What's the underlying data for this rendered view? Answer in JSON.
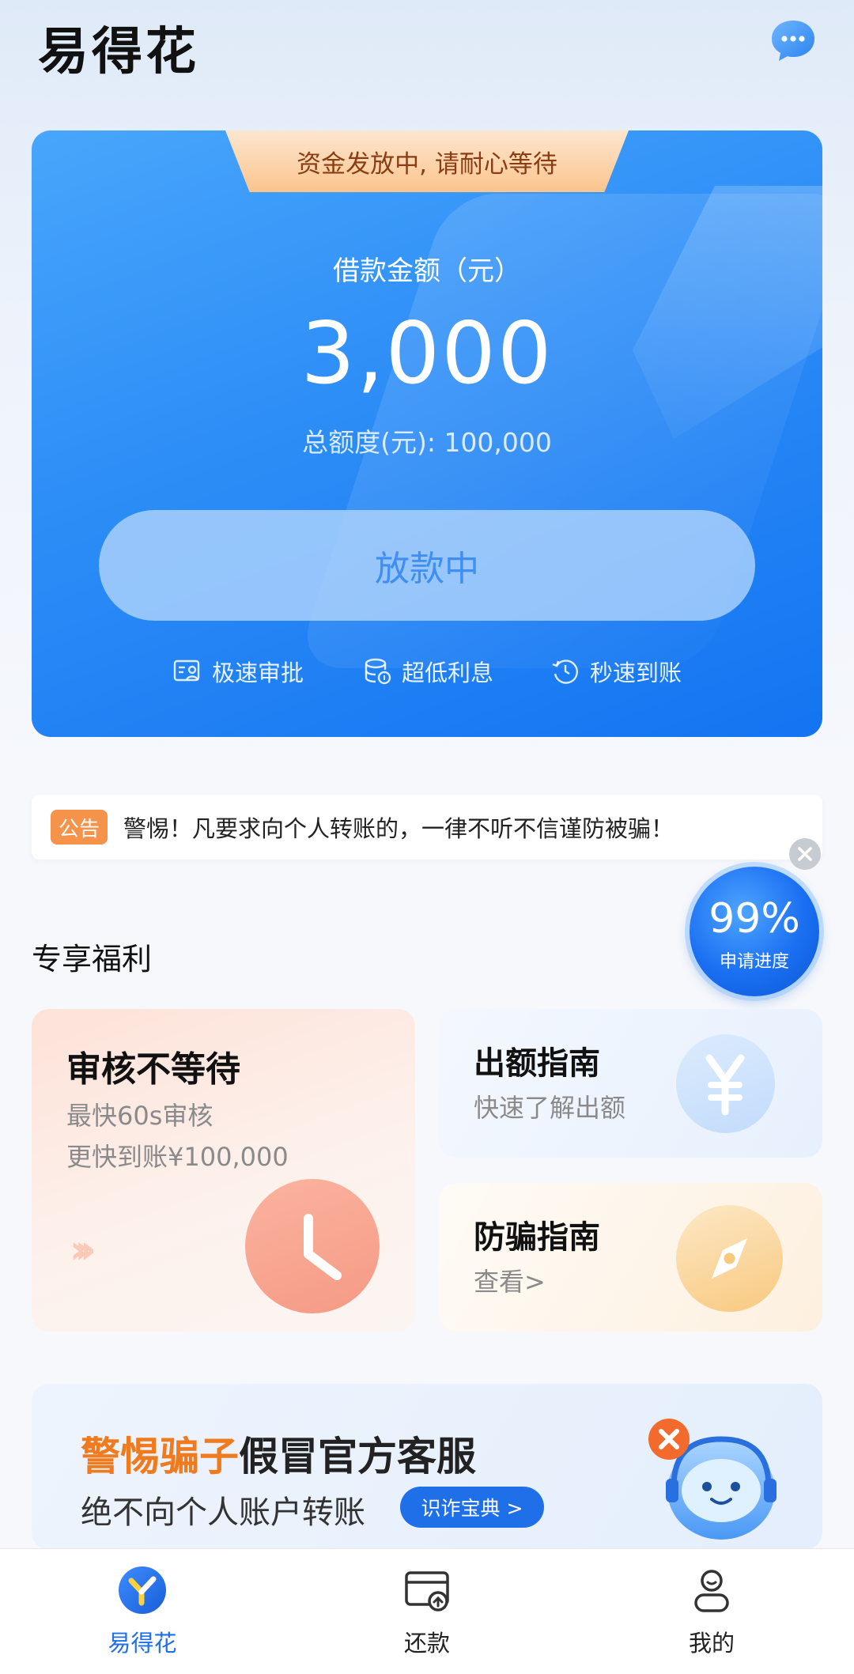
{
  "header": {
    "app_title": "易得花"
  },
  "hero": {
    "banner_text": "资金发放中, 请耐心等待",
    "loan_label": "借款金额（元）",
    "loan_amount": "3,000",
    "total_limit": "总额度(元): 100,000",
    "button_label": "放款中",
    "features": [
      "极速审批",
      "超低利息",
      "秒速到账"
    ]
  },
  "notice": {
    "tag": "公告",
    "text": "警惕！凡要求向个人转账的，一律不听不信谨防被骗！"
  },
  "progress_float": {
    "percent": "99%",
    "label": "申请进度"
  },
  "benefits": {
    "section_title": "专享福利",
    "review": {
      "title": "审核不等待",
      "line1": "最快60s审核",
      "line2": "更快到账¥100,000"
    },
    "quota_guide": {
      "title": "出额指南",
      "subtitle": "快速了解出额"
    },
    "fraud_guide": {
      "title": "防骗指南",
      "subtitle": "查看>"
    }
  },
  "banner": {
    "title_highlight": "警惕骗子",
    "title_rest": "假冒官方客服",
    "subtitle": "绝不向个人账户转账",
    "button_label": "识诈宝典 >"
  },
  "tabbar": {
    "items": [
      {
        "label": "易得花",
        "icon": "brand-logo-icon",
        "active": true
      },
      {
        "label": "还款",
        "icon": "repay-card-icon",
        "active": false
      },
      {
        "label": "我的",
        "icon": "user-profile-icon",
        "active": false
      }
    ]
  },
  "colors": {
    "primary": "#1f6fe8",
    "accent_orange": "#f07b1e",
    "notice_tag": "#f5934b"
  }
}
